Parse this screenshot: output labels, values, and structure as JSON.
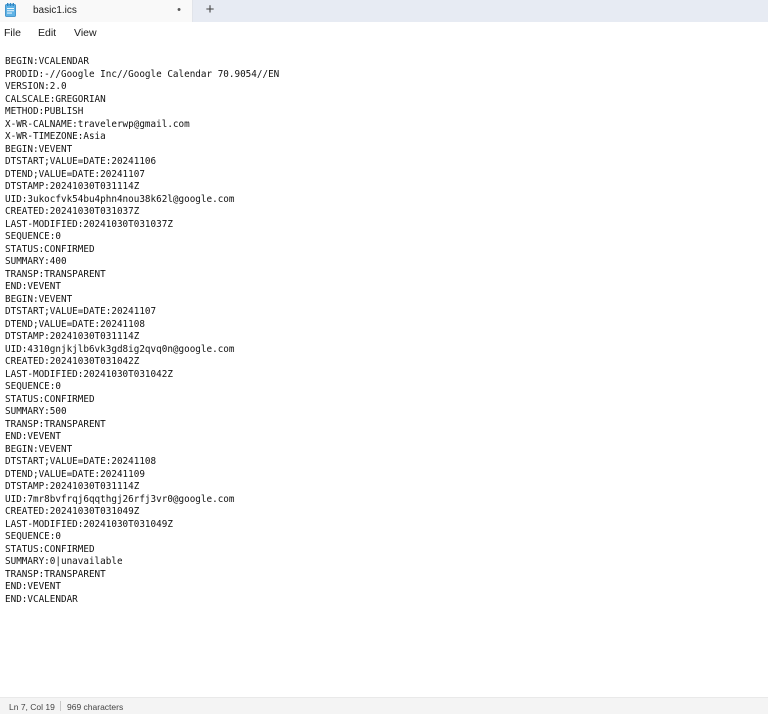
{
  "tab": {
    "title": "basic1.ics",
    "modified_indicator": "•",
    "new_tab_label": "+",
    "icon": "notepad-icon"
  },
  "menu": {
    "file": "File",
    "edit": "Edit",
    "view": "View"
  },
  "document": {
    "lines": [
      "BEGIN:VCALENDAR",
      "PRODID:-//Google Inc//Google Calendar 70.9054//EN",
      "VERSION:2.0",
      "CALSCALE:GREGORIAN",
      "METHOD:PUBLISH",
      "X-WR-CALNAME:travelerwp@gmail.com",
      "X-WR-TIMEZONE:Asia",
      "BEGIN:VEVENT",
      "DTSTART;VALUE=DATE:20241106",
      "DTEND;VALUE=DATE:20241107",
      "DTSTAMP:20241030T031114Z",
      "UID:3ukocfvk54bu4phn4nou38k62l@google.com",
      "CREATED:20241030T031037Z",
      "LAST-MODIFIED:20241030T031037Z",
      "SEQUENCE:0",
      "STATUS:CONFIRMED",
      "SUMMARY:400",
      "TRANSP:TRANSPARENT",
      "END:VEVENT",
      "BEGIN:VEVENT",
      "DTSTART;VALUE=DATE:20241107",
      "DTEND;VALUE=DATE:20241108",
      "DTSTAMP:20241030T031114Z",
      "UID:4310gnjkjlb6vk3gd8ig2qvq0n@google.com",
      "CREATED:20241030T031042Z",
      "LAST-MODIFIED:20241030T031042Z",
      "SEQUENCE:0",
      "STATUS:CONFIRMED",
      "SUMMARY:500",
      "TRANSP:TRANSPARENT",
      "END:VEVENT",
      "BEGIN:VEVENT",
      "DTSTART;VALUE=DATE:20241108",
      "DTEND;VALUE=DATE:20241109",
      "DTSTAMP:20241030T031114Z",
      "UID:7mr8bvfrqj6qqthgj26rfj3vr0@google.com",
      "CREATED:20241030T031049Z",
      "LAST-MODIFIED:20241030T031049Z",
      "SEQUENCE:0",
      "STATUS:CONFIRMED",
      "SUMMARY:0|unavailable",
      "TRANSP:TRANSPARENT",
      "END:VEVENT",
      "END:VCALENDAR"
    ]
  },
  "status": {
    "position": "Ln 7, Col 19",
    "char_count": "969 characters"
  }
}
